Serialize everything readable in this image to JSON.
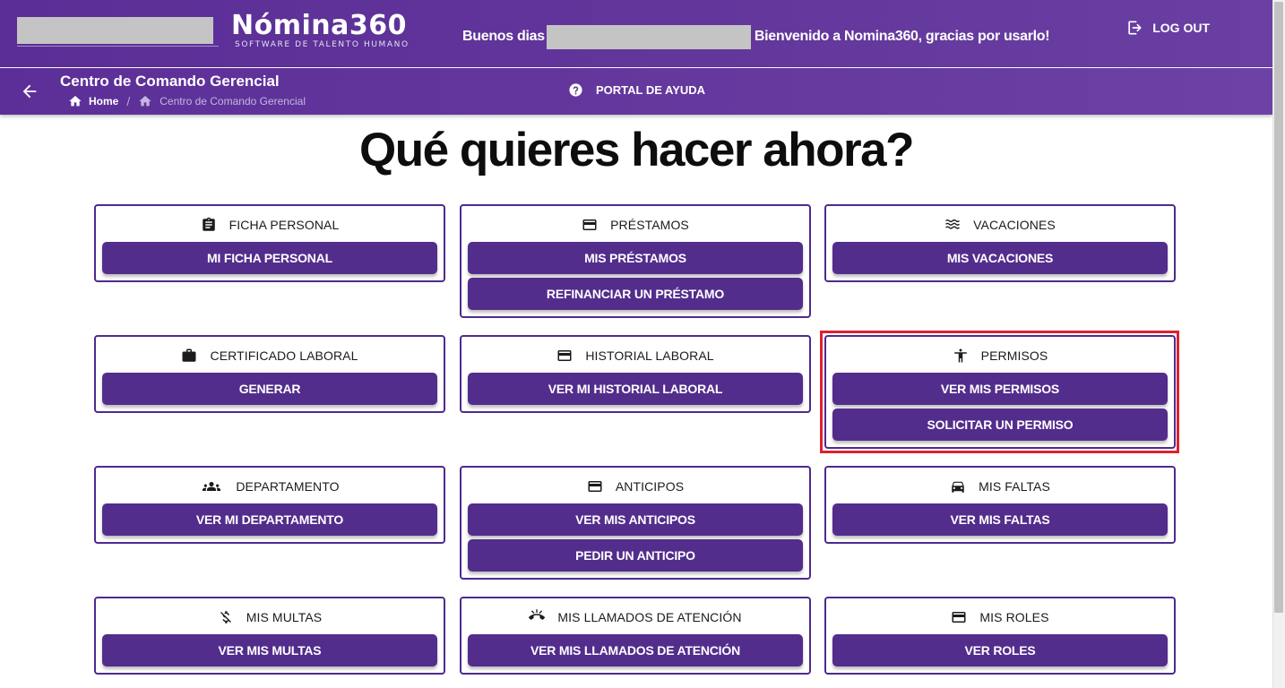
{
  "header": {
    "logo_main": "Nómina360",
    "logo_sub": "SOFTWARE DE TALENTO HUMANO",
    "greeting_prefix": "Buenos dias",
    "greeting_suffix": "Bienvenido a Nomina360, gracias por usarlo!",
    "logout_label": "LOG OUT"
  },
  "subheader": {
    "page_title": "Centro de Comando Gerencial",
    "breadcrumb": {
      "home": "Home",
      "current": "Centro de Comando Gerencial"
    },
    "help_label": "PORTAL DE AYUDA"
  },
  "main": {
    "title": "Qué quieres hacer ahora?",
    "cards": [
      {
        "title": "FICHA PERSONAL",
        "icon": "clipboard-icon",
        "buttons": [
          "MI FICHA PERSONAL"
        ]
      },
      {
        "title": "PRÉSTAMOS",
        "icon": "credit-card-icon",
        "buttons": [
          "MIS PRÉSTAMOS",
          "REFINANCIAR UN PRÉSTAMO"
        ]
      },
      {
        "title": "VACACIONES",
        "icon": "waves-icon",
        "buttons": [
          "MIS VACACIONES"
        ]
      },
      {
        "title": "CERTIFICADO LABORAL",
        "icon": "briefcase-icon",
        "buttons": [
          "GENERAR"
        ]
      },
      {
        "title": "HISTORIAL LABORAL",
        "icon": "credit-card-icon",
        "buttons": [
          "VER MI HISTORIAL LABORAL"
        ]
      },
      {
        "title": "PERMISOS",
        "icon": "accessibility-icon",
        "buttons": [
          "VER MIS PERMISOS",
          "SOLICITAR UN PERMISO"
        ]
      },
      {
        "title": "DEPARTAMENTO",
        "icon": "people-icon",
        "buttons": [
          "VER MI DEPARTAMENTO"
        ]
      },
      {
        "title": "ANTICIPOS",
        "icon": "credit-card-icon",
        "buttons": [
          "VER MIS ANTICIPOS",
          "PEDIR UN ANTICIPO"
        ]
      },
      {
        "title": "MIS FALTAS",
        "icon": "car-icon",
        "buttons": [
          "VER MIS FALTAS"
        ]
      },
      {
        "title": "MIS MULTAS",
        "icon": "money-off-icon",
        "buttons": [
          "VER MIS MULTAS"
        ]
      },
      {
        "title": "MIS LLAMADOS DE ATENCIÓN",
        "icon": "phone-callback-icon",
        "buttons": [
          "VER MIS LLAMADOS DE ATENCIÓN"
        ]
      },
      {
        "title": "MIS ROLES",
        "icon": "credit-card-icon",
        "buttons": [
          "VER ROLES"
        ]
      }
    ]
  },
  "colors": {
    "header_bg": "#5a2e96",
    "button_bg": "#532d8c",
    "card_border": "#4e2a8e",
    "highlight": "#e0202e"
  }
}
